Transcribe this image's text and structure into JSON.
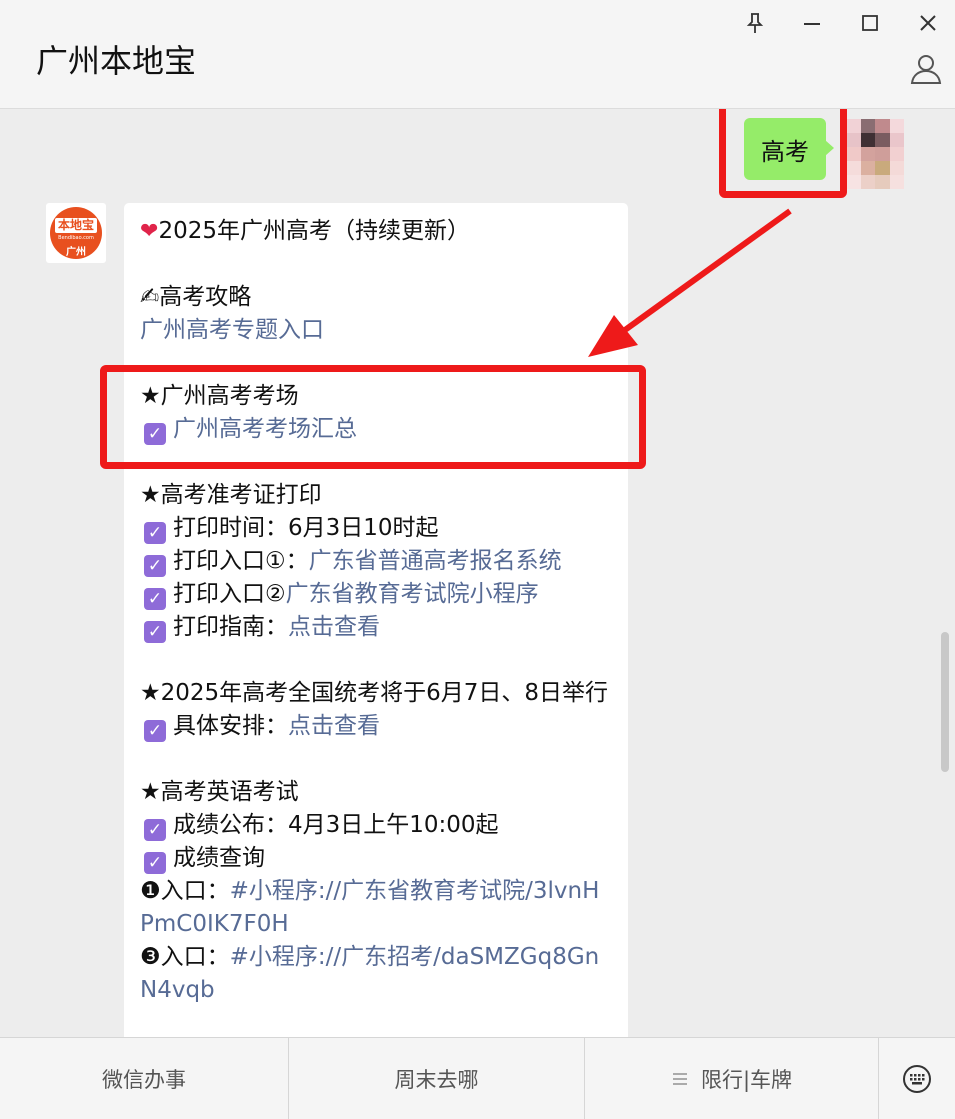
{
  "window": {
    "title": "广州本地宝",
    "pin_icon": "pin-icon",
    "minimize_icon": "minimize-icon",
    "maximize_icon": "maximize-icon",
    "close_icon": "close-icon",
    "profile_icon": "profile-icon"
  },
  "chat": {
    "user_message": "高考",
    "bot_avatar": {
      "logo_text": "本地宝",
      "logo_sub": "Bendibao.com",
      "logo_city": "广州"
    },
    "reply": {
      "title": "2025年广州高考（持续更新）",
      "strategy_heading": "高考攻略",
      "strategy_link": "广州高考专题入口",
      "venue_heading": "★广州高考考场",
      "venue_link": "广州高考考场汇总",
      "admission_heading": "★高考准考证打印",
      "print_time": "打印时间：6月3日10时起",
      "entry1_label": "打印入口①：",
      "entry1_link": "广东省普通高考报名系统",
      "entry2_label": "打印入口②",
      "entry2_link": "广东省教育考试院小程序",
      "guide_label": "打印指南：",
      "guide_link": "点击查看",
      "exam_heading": "★2025年高考全国统考将于6月7日、8日举行",
      "schedule_label": "具体安排：",
      "schedule_link": "点击查看",
      "english_heading": "★高考英语考试",
      "score_release": "成绩公布：4月3日上午10:00起",
      "score_query": "成绩查询",
      "entry_a_label": "❶入口：",
      "entry_a_link": "#小程序://广东省教育考试院/3lvnHPmC0IK7F0H",
      "entry_b_label": "❸入口：",
      "entry_b_link": "#小程序://广东招考/daSMZGq8GnN4vqb"
    }
  },
  "bottom_menu": {
    "item1": "微信办事",
    "item2": "周末去哪",
    "item3": "限行|车牌",
    "item3_icon": "menu-lines-icon",
    "keyboard_icon": "keyboard-icon"
  },
  "colors": {
    "highlight": "#ee1a1a",
    "user_bubble": "#95ec69",
    "link": "#576b95",
    "checkbox": "#8e6bd8"
  }
}
